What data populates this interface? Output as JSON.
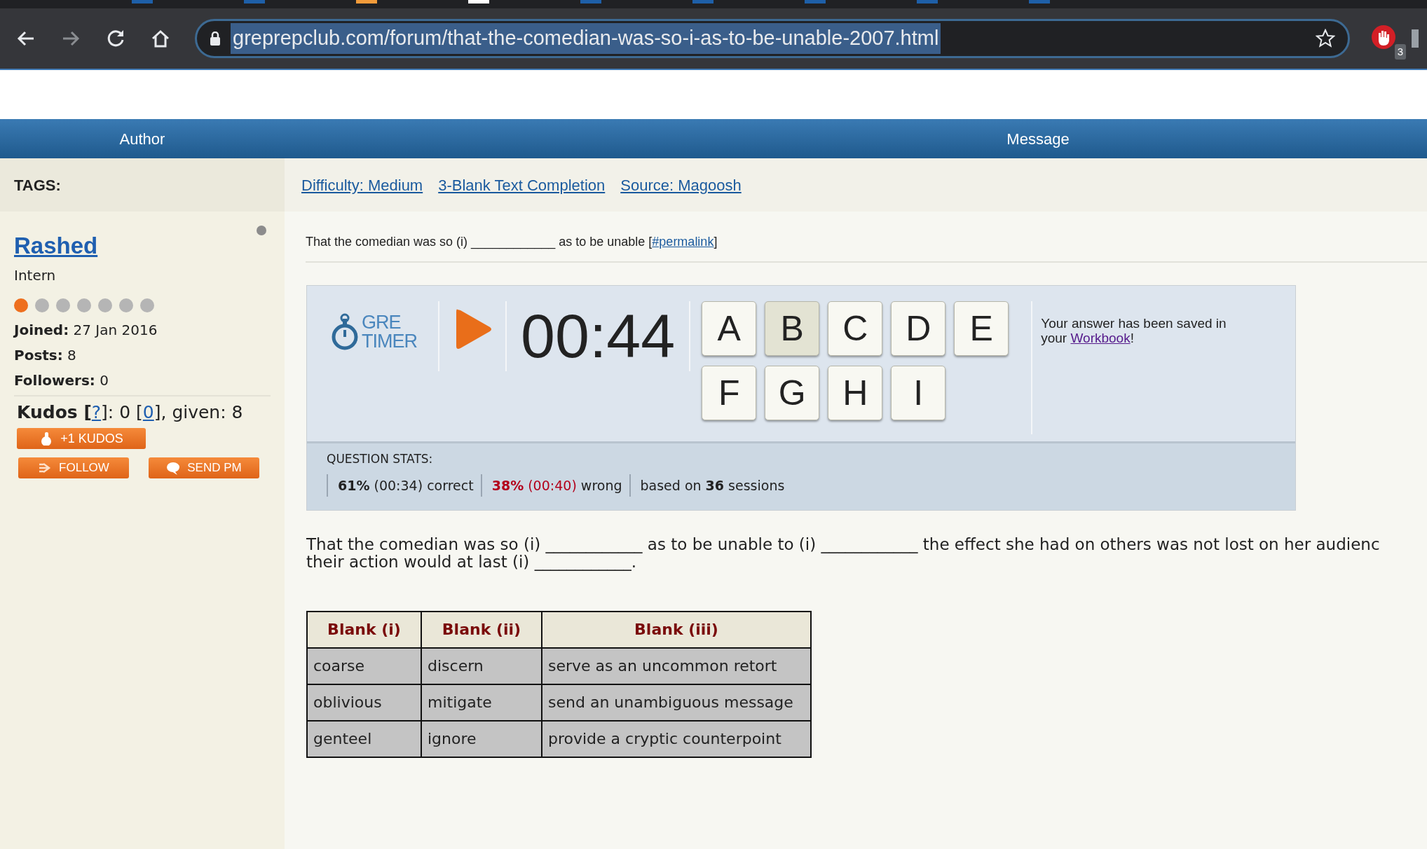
{
  "browser": {
    "url": "greprepclub.com/forum/that-the-comedian-was-so-i-as-to-be-unable-2007.html",
    "url_selected": true,
    "extension_badge": "3"
  },
  "header": {
    "author": "Author",
    "message": "Message"
  },
  "tags": {
    "label": "TAGS:",
    "links": [
      "Difficulty: Medium",
      "3-Blank Text Completion",
      "Source: Magoosh"
    ]
  },
  "author": {
    "name": "Rashed",
    "online": false,
    "rank": "Intern",
    "rank_dots": [
      {
        "on": true
      },
      {
        "on": false
      },
      {
        "on": false
      },
      {
        "on": false
      },
      {
        "on": false
      },
      {
        "on": false
      },
      {
        "on": false
      }
    ],
    "facts": [
      {
        "label": "Joined:",
        "value": "27 Jan 2016"
      },
      {
        "label": "Posts:",
        "value": "8"
      },
      {
        "label": "Followers:",
        "value": "0"
      }
    ],
    "kudos": {
      "label": "Kudos [",
      "help": "?",
      "mid": "]: 0 [",
      "count": "0",
      "end": "], given: 8"
    },
    "buttons": [
      {
        "kind": "kudos",
        "label": "+1 KUDOS"
      },
      {
        "kind": "follow",
        "label": "FOLLOW"
      },
      {
        "kind": "pm",
        "label": "SEND PM"
      }
    ]
  },
  "post": {
    "intro": "That the comedian was so (i) ____________ as to be unable [",
    "permalink": "#permalink",
    "intro_end": "]"
  },
  "timer": {
    "logo_top": "GRE",
    "logo_bottom": "TIMER",
    "time": "00:44",
    "choices": [
      {
        "label": "A",
        "selected": false
      },
      {
        "label": "B",
        "selected": true
      },
      {
        "label": "C",
        "selected": false
      },
      {
        "label": "D",
        "selected": false
      },
      {
        "label": "E",
        "selected": false
      },
      {
        "label": "F",
        "selected": false
      },
      {
        "label": "G",
        "selected": false
      },
      {
        "label": "H",
        "selected": false
      },
      {
        "label": "I",
        "selected": false
      }
    ],
    "saved_text": "Your answer has been saved in your ",
    "workbook": "Workbook",
    "saved_end": "!",
    "stats_title": "QUESTION STATS:",
    "stats": [
      {
        "kind": "correct",
        "percent": "61%",
        "time": "(00:34)",
        "label": "correct"
      },
      {
        "kind": "wrong",
        "percent": "38%",
        "time": "(00:40)",
        "label": "wrong"
      }
    ],
    "sessions": "based on **36** sessions"
  },
  "question": [
    "That the comedian was so (i) ____________ as to be unable to (i) ____________ the effect she had on others was not lost on her audienc",
    "their action would at last (i) ____________."
  ],
  "table": {
    "columns": [
      "Blank (i)",
      "Blank (ii)",
      "Blank (iii)"
    ],
    "rows": [
      [
        "coarse",
        "discern",
        "serve as an uncommon retort"
      ],
      [
        "oblivious",
        "mitigate",
        "send an unambiguous message"
      ],
      [
        "genteel",
        "ignore",
        "provide a cryptic counterpoint"
      ]
    ]
  }
}
